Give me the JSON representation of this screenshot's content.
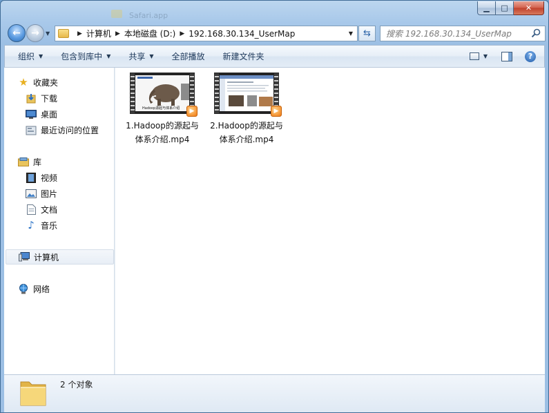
{
  "window": {
    "ghost_title": "Safari.app"
  },
  "address_bar": {
    "crumbs": [
      "计算机",
      "本地磁盘 (D:)",
      "192.168.30.134_UserMap"
    ]
  },
  "search": {
    "placeholder": "搜索 192.168.30.134_UserMap"
  },
  "toolbar": {
    "organize": "组织",
    "include_library": "包含到库中",
    "share": "共享",
    "play_all": "全部播放",
    "new_folder": "新建文件夹"
  },
  "nav": {
    "favorites": "收藏夹",
    "downloads": "下载",
    "desktop": "桌面",
    "recent": "最近访问的位置",
    "libraries": "库",
    "videos": "视频",
    "pictures": "图片",
    "documents": "文档",
    "music": "音乐",
    "computer": "计算机",
    "network": "网络"
  },
  "files": [
    {
      "name": "1.Hadoop的源起与体系介绍.mp4",
      "thumb_caption": "Hadoop源起与体系介绍"
    },
    {
      "name": "2.Hadoop的源起与体系介绍.mp4"
    }
  ],
  "status": {
    "count": "2 个对象"
  },
  "colors": {
    "accent_blue": "#2f6fb8",
    "play_orange": "#f07a12"
  }
}
